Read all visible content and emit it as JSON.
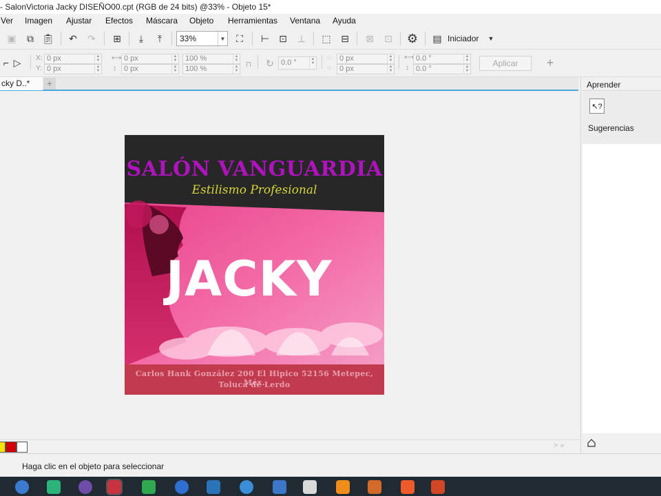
{
  "window": {
    "title": "- SalonVictoria Jacky DISEÑO00.cpt (RGB de 24 bits) @33% - Objeto 15*"
  },
  "menu": {
    "items": [
      "Ver",
      "Imagen",
      "Ajustar",
      "Efectos",
      "Máscara",
      "Objeto",
      "Herramientas",
      "Ventana",
      "Ayuda"
    ]
  },
  "toolbar": {
    "zoom_value": "33%",
    "launcher_label": "Iniciador"
  },
  "properties": {
    "x": "0 px",
    "y": "0 px",
    "w": "0 px",
    "h": "0 px",
    "scale_w": "100 %",
    "scale_h": "100 %",
    "angle": "0.0 °",
    "cx": "0 px",
    "cy": "0 px",
    "skew_h": "0.0 °",
    "skew_v": "0.0 °",
    "x_label": "X:",
    "y_label": "Y:",
    "apply_label": "Aplicar"
  },
  "document": {
    "tab_label": "cky D..*"
  },
  "artwork": {
    "title": "SALÓN VANGUARDIA",
    "subtitle": "Estilismo Profesional",
    "name": "JACKY",
    "address_line1": "Carlos Hank González 200 El Hipico 52156 Metepec, Méx.",
    "address_line2": "Toluca de Lerdo"
  },
  "panel": {
    "title": "Aprender",
    "hint_label": "Sugerencias"
  },
  "palette": {
    "colors": [
      "#f5e400",
      "#d40000",
      "#ffffff"
    ]
  },
  "status": {
    "text": "Haga clic en el objeto para seleccionar"
  }
}
